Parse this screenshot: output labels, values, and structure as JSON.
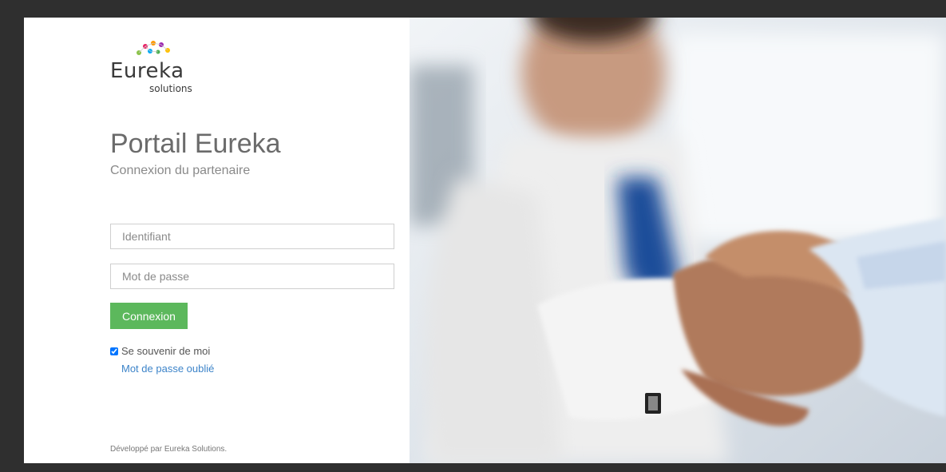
{
  "logo": {
    "word": "Eureka",
    "sub": "solutions"
  },
  "page": {
    "title": "Portail Eureka",
    "subtitle": "Connexion du partenaire"
  },
  "form": {
    "username_placeholder": "Identifiant",
    "username_value": "",
    "password_placeholder": "Mot de passe",
    "password_value": "",
    "submit_label": "Connexion",
    "remember_label": "Se souvenir de moi",
    "remember_checked": true,
    "forgot_label": "Mot de passe oublié"
  },
  "footer": {
    "credit": "Développé par Eureka Solutions."
  },
  "colors": {
    "accent_green": "#5cb85c",
    "link_blue": "#3d84c9",
    "text_gray": "#6b6b6b"
  },
  "image": {
    "icon": "handshake-photo"
  }
}
